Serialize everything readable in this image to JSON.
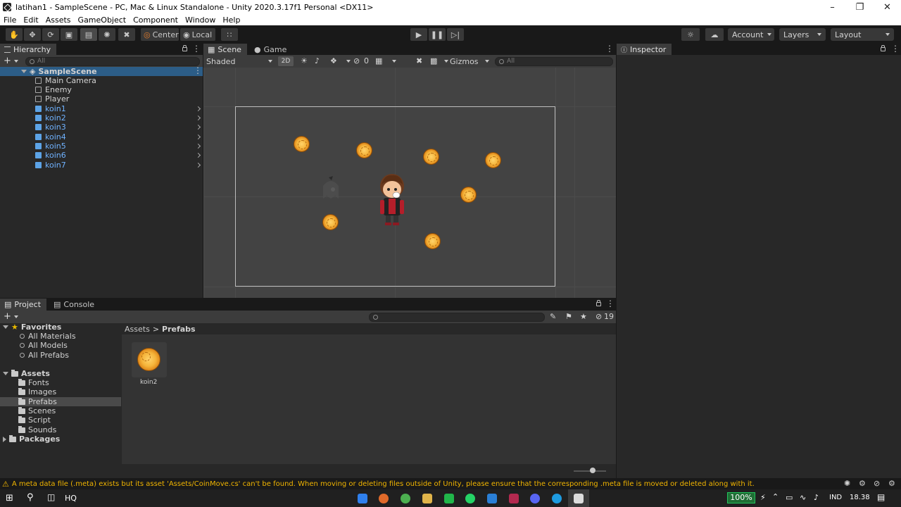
{
  "window": {
    "title": "latihan1 - SampleScene - PC, Mac & Linux Standalone - Unity 2020.3.17f1 Personal <DX11>"
  },
  "menu": [
    "File",
    "Edit",
    "Assets",
    "GameObject",
    "Component",
    "Window",
    "Help"
  ],
  "toolbar": {
    "pivot_label": "Center",
    "space_label": "Local",
    "account_label": "Account",
    "layers_label": "Layers",
    "layout_label": "Layout"
  },
  "hierarchy": {
    "tab_label": "Hierarchy",
    "search_placeholder": "All",
    "scene_name": "SampleScene",
    "items": [
      {
        "label": "Main Camera",
        "prefab": false
      },
      {
        "label": "Enemy",
        "prefab": false
      },
      {
        "label": "Player",
        "prefab": false
      },
      {
        "label": "koin1",
        "prefab": true
      },
      {
        "label": "koin2",
        "prefab": true
      },
      {
        "label": "koin3",
        "prefab": true
      },
      {
        "label": "koin4",
        "prefab": true
      },
      {
        "label": "koin5",
        "prefab": true
      },
      {
        "label": "koin6",
        "prefab": true
      },
      {
        "label": "koin7",
        "prefab": true
      }
    ]
  },
  "scene": {
    "tab_scene": "Scene",
    "tab_game": "Game",
    "shading_mode": "Shaded",
    "mode_2d": "2D",
    "hidden_count": "0",
    "gizmos_label": "Gizmos",
    "search_placeholder": "All"
  },
  "inspector": {
    "tab_label": "Inspector"
  },
  "project": {
    "tab_project": "Project",
    "tab_console": "Console",
    "hidden_count": "19",
    "favorites_label": "Favorites",
    "favorites": [
      "All Materials",
      "All Models",
      "All Prefabs"
    ],
    "assets_label": "Assets",
    "asset_folders": [
      "Fonts",
      "Images",
      "Prefabs",
      "Scenes",
      "Script",
      "Sounds"
    ],
    "packages_label": "Packages",
    "breadcrumb_root": "Assets",
    "breadcrumb_current": "Prefabs",
    "files": [
      {
        "label": "koin2"
      }
    ]
  },
  "status": {
    "message": "A meta data file (.meta) exists but its asset 'Assets/CoinMove.cs' can't be found. When moving or deleting files outside of Unity, please ensure that the corresponding .meta file is moved or deleted along with it."
  },
  "taskbar": {
    "search_label": "HQ",
    "battery": "100%",
    "language": "IND",
    "clock": "18.38"
  },
  "colors": {
    "accent_blue": "#6fb2ff",
    "warning_yellow": "#f0b400",
    "coin_gold": "#f5b43a"
  }
}
